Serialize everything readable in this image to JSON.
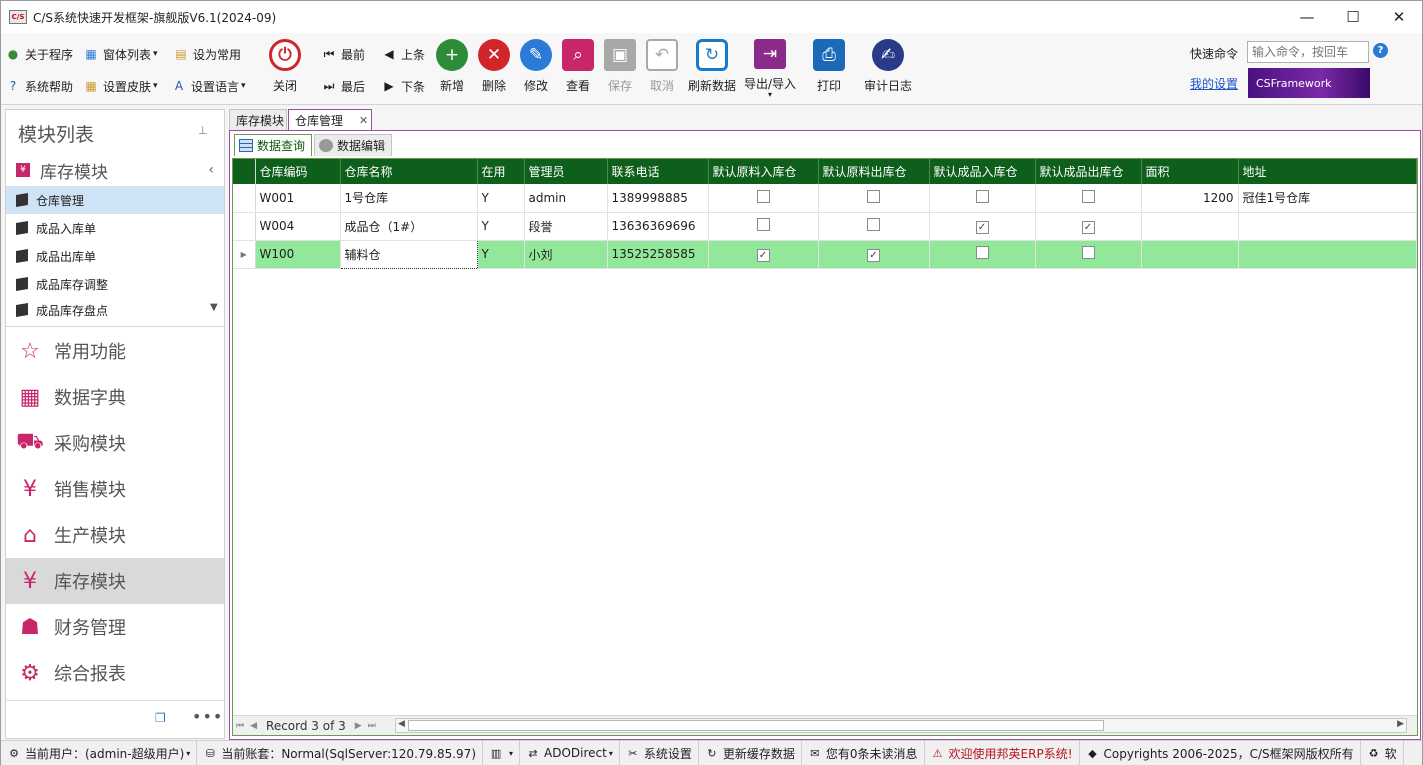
{
  "window": {
    "title": "C/S系统快速开发框架-旗舰版V6.1(2024-09)",
    "logo_text": "C/S"
  },
  "ribbon": {
    "small_left": [
      {
        "label": "关于程序",
        "icon": "globe-icon"
      },
      {
        "label": "窗体列表",
        "icon": "windows-icon"
      },
      {
        "label": "设为常用",
        "icon": "clipboard-icon"
      },
      {
        "label": "系统帮助",
        "icon": "help-icon"
      },
      {
        "label": "设置皮肤",
        "icon": "palette-icon"
      },
      {
        "label": "设置语言",
        "icon": "language-icon"
      }
    ],
    "close_label": "关闭",
    "nav": {
      "first": "最前",
      "prev": "上条",
      "last": "最后",
      "next": "下条"
    },
    "actions": [
      {
        "label": "新增",
        "icon": "add-db-icon",
        "color": "#2e8b3a",
        "enabled": true
      },
      {
        "label": "删除",
        "icon": "delete-db-icon",
        "color": "#d0262a",
        "enabled": true
      },
      {
        "label": "修改",
        "icon": "edit-db-icon",
        "color": "#2a7ad6",
        "enabled": true
      },
      {
        "label": "查看",
        "icon": "view-icon",
        "color": "#c8266a",
        "enabled": true
      },
      {
        "label": "保存",
        "icon": "save-icon",
        "color": "#a8a8a8",
        "enabled": false
      },
      {
        "label": "取消",
        "icon": "undo-icon",
        "color": "#a8a8a8",
        "enabled": false
      },
      {
        "label": "刷新数据",
        "icon": "refresh-icon",
        "color": "#1a7ac8",
        "enabled": true
      },
      {
        "label": "导出/导入",
        "icon": "export-icon",
        "color": "#8a2a8a",
        "enabled": true
      },
      {
        "label": "打印",
        "icon": "printer-icon",
        "color": "#1a6ab8",
        "enabled": true
      },
      {
        "label": "审计日志",
        "icon": "audit-log-icon",
        "color": "#2a3a8a",
        "enabled": true
      }
    ],
    "quick_cmd_label": "快速命令",
    "quick_cmd_placeholder": "输入命令，按回车",
    "my_settings": "我的设置",
    "banner_text": "CSFramework"
  },
  "sidebar": {
    "header": "模块列表",
    "group": "库存模块",
    "items": [
      "仓库管理",
      "成品入库单",
      "成品出库单",
      "成品库存调整",
      "成品库存盘点"
    ],
    "selected_item": 0,
    "modules": [
      {
        "label": "常用功能",
        "icon": "star-icon"
      },
      {
        "label": "数据字典",
        "icon": "dictionary-icon"
      },
      {
        "label": "采购模块",
        "icon": "cart-icon"
      },
      {
        "label": "销售模块",
        "icon": "bag-icon"
      },
      {
        "label": "生产模块",
        "icon": "factory-icon"
      },
      {
        "label": "库存模块",
        "icon": "inventory-icon"
      },
      {
        "label": "财务管理",
        "icon": "user-icon"
      },
      {
        "label": "综合报表",
        "icon": "report-icon"
      }
    ],
    "selected_module": 5
  },
  "tabs": {
    "doc": [
      "库存模块",
      "仓库管理"
    ],
    "active_doc": 1,
    "sub": [
      "数据查询",
      "数据编辑"
    ],
    "active_sub": 0
  },
  "grid": {
    "columns": [
      "仓库编码",
      "仓库名称",
      "在用",
      "管理员",
      "联系电话",
      "默认原料入库仓",
      "默认原料出库仓",
      "默认成品入库仓",
      "默认成品出库仓",
      "面积",
      "地址"
    ],
    "rows": [
      {
        "code": "W001",
        "name": "1号仓库",
        "active": "Y",
        "admin": "admin",
        "phone": "1389998885",
        "c1": false,
        "c2": false,
        "c3": false,
        "c4": false,
        "area": "1200",
        "addr": "冠佳1号仓库"
      },
      {
        "code": "W004",
        "name": "成品仓（1#）",
        "active": "Y",
        "admin": "段誉",
        "phone": "13636369696",
        "c1": false,
        "c2": false,
        "c3": true,
        "c4": true,
        "area": "",
        "addr": ""
      },
      {
        "code": "W100",
        "name": "辅料仓",
        "active": "Y",
        "admin": "小刘",
        "phone": "13525258585",
        "c1": true,
        "c2": true,
        "c3": false,
        "c4": false,
        "area": "",
        "addr": ""
      }
    ],
    "current_row": 2,
    "record_text": "Record 3 of 3"
  },
  "status": [
    {
      "label": "当前用户：(admin-超级用户)",
      "icon": "users-icon",
      "dropdown": true
    },
    {
      "label": "当前账套：Normal(SqlServer:120.79.85.97)",
      "icon": "database-icon",
      "dropdown": false
    },
    {
      "label": "",
      "icon": "building-icon",
      "dropdown": true
    },
    {
      "label": "ADODirect",
      "icon": "connection-icon",
      "dropdown": true
    },
    {
      "label": "系统设置",
      "icon": "tools-icon",
      "dropdown": false
    },
    {
      "label": "更新缓存数据",
      "icon": "refresh-icon",
      "dropdown": false
    },
    {
      "label": "您有0条未读消息",
      "icon": "mail-icon",
      "dropdown": false
    },
    {
      "label": "欢迎使用邦英ERP系统!",
      "icon": "warning-icon",
      "dropdown": false,
      "red": true
    },
    {
      "label": "Copyrights 2006-2025，C/S框架网版权所有",
      "icon": "cube-icon",
      "dropdown": false
    },
    {
      "label": "软",
      "icon": "recycle-icon",
      "dropdown": false
    }
  ]
}
